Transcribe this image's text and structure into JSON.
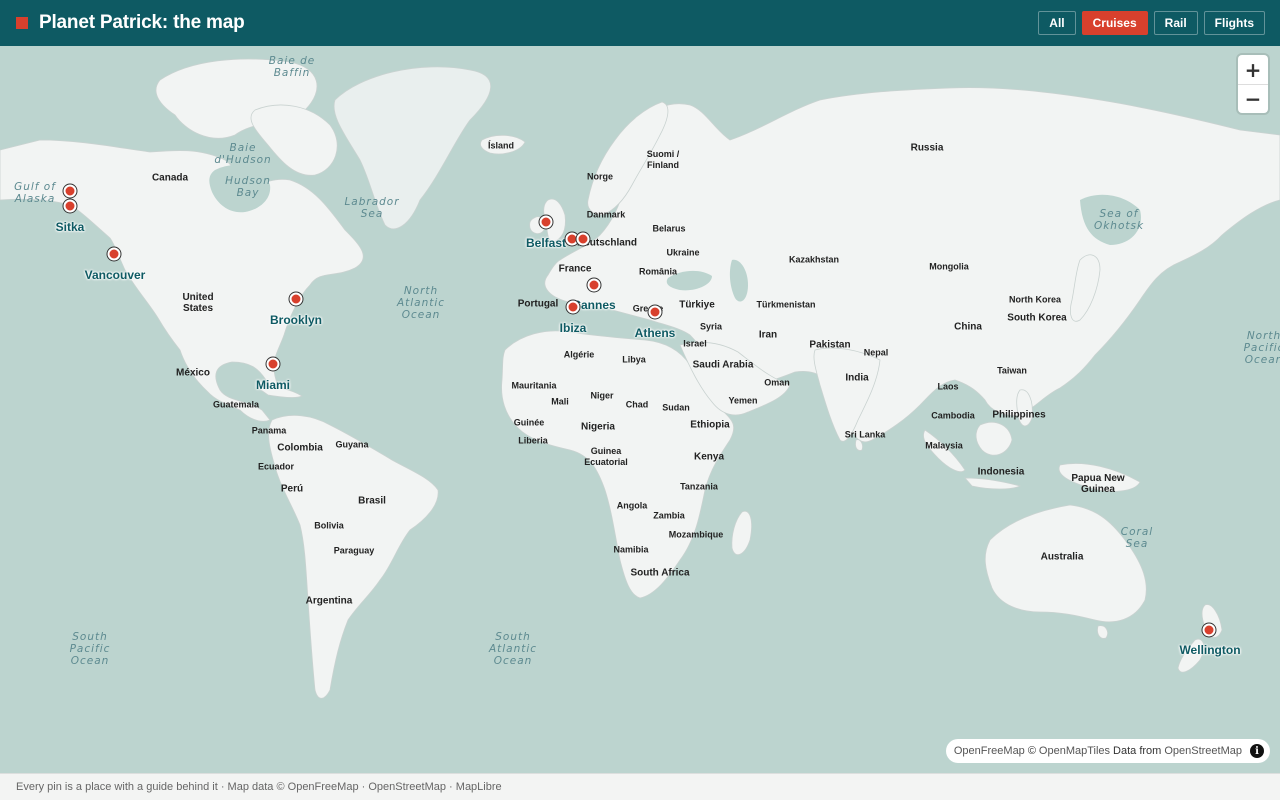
{
  "header": {
    "title": "Planet Patrick: the map",
    "filters": [
      {
        "label": "All",
        "active": false
      },
      {
        "label": "Cruises",
        "active": true
      },
      {
        "label": "Rail",
        "active": false
      },
      {
        "label": "Flights",
        "active": false
      }
    ]
  },
  "colors": {
    "header_bg": "#0e5a63",
    "accent": "#d8402d",
    "water": "#bcd4cf",
    "land": "#f2f4f3"
  },
  "map": {
    "country_labels": [
      "Canada",
      "United\nStates",
      "México",
      "Guatemala",
      "Panama",
      "Colombia",
      "Guyana",
      "Ecuador",
      "Perú",
      "Brasil",
      "Bolivia",
      "Paraguay",
      "Argentina",
      "Ísland",
      "Norge",
      "Suomi /\nFinland",
      "Danmark",
      "Belarus",
      "Deutschland",
      "Ukraine",
      "France",
      "România",
      "Portugal",
      "Türkiye",
      "Greece",
      "Syria",
      "Israel",
      "Algérie",
      "Libya",
      "Saudi Arabia",
      "Mauritania",
      "Mali",
      "Niger",
      "Chad",
      "Sudan",
      "Guinée",
      "Nigeria",
      "Ethiopia",
      "Liberia",
      "Guinea\nEcuatorial",
      "Kenya",
      "Tanzania",
      "Angola",
      "Zambia",
      "Mozambique",
      "Namibia",
      "South Africa",
      "Russia",
      "Kazakhstan",
      "Mongolia",
      "Türkmenistan",
      "Iran",
      "Pakistan",
      "Oman",
      "Yemen",
      "India",
      "Nepal",
      "China",
      "North Korea",
      "South Korea",
      "Taiwan",
      "Laos",
      "Cambodia",
      "Philippines",
      "Malaysia",
      "Sri Lanka",
      "Indonesia",
      "Papua New\nGuinea",
      "Australia"
    ],
    "ocean_labels": [
      "Baie de\nBaffin",
      "Baie\nd'Hudson",
      "Hudson\nBay",
      "Gulf of\nAlaska",
      "Labrador\nSea",
      "North\nAtlantic\nOcean",
      "Sea of\nOkhotsk",
      "North\nPacific\nOcean",
      "South\nPacific\nOcean",
      "South\nAtlantic\nOcean",
      "Coral\nSea"
    ],
    "pins": [
      {
        "label": "Sitka",
        "show_label": true
      },
      {
        "label": "",
        "show_label": false
      },
      {
        "label": "Vancouver",
        "show_label": true
      },
      {
        "label": "Brooklyn",
        "show_label": true
      },
      {
        "label": "Miami",
        "show_label": true
      },
      {
        "label": "Belfast",
        "show_label": true
      },
      {
        "label": "",
        "show_label": false
      },
      {
        "label": "",
        "show_label": false
      },
      {
        "label": "Cannes",
        "show_label": true
      },
      {
        "label": "Ibiza",
        "show_label": true
      },
      {
        "label": "Athens",
        "show_label": true
      },
      {
        "label": "Wellington",
        "show_label": true
      }
    ]
  },
  "zoom": {
    "in_label": "+",
    "out_label": "−"
  },
  "attribution": {
    "openfreemap": "OpenFreeMap",
    "copyright": "©",
    "openmaptiles": "OpenMapTiles",
    "data_from": "Data from",
    "openstreetmap": "OpenStreetMap",
    "info_icon": "i"
  },
  "footer": {
    "text": "Every pin is a place with a guide behind it · Map data © OpenFreeMap · OpenStreetMap · MapLibre"
  }
}
